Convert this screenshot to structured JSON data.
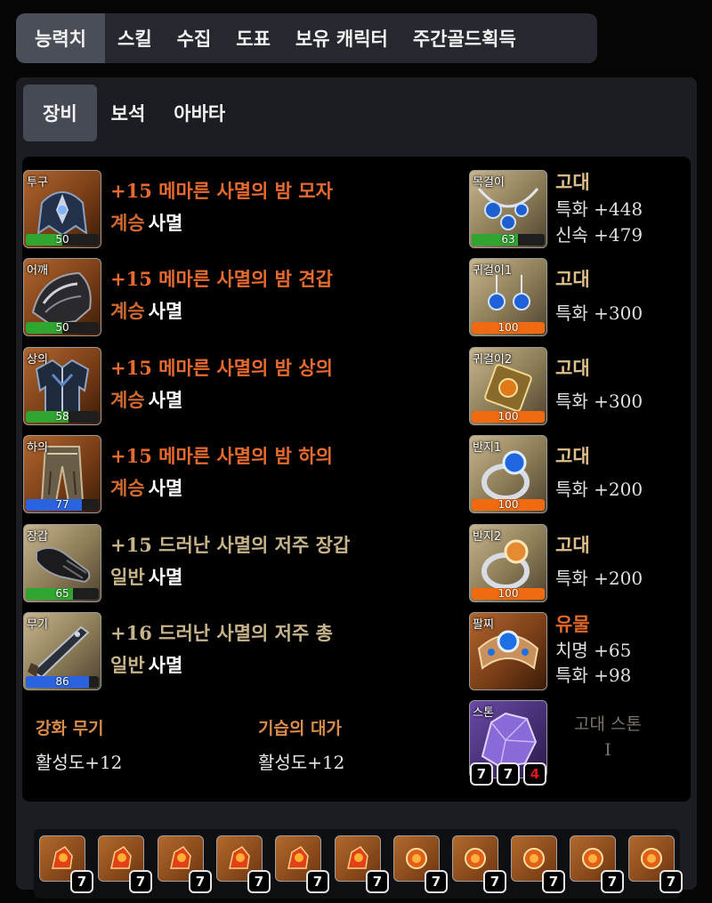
{
  "top_tabs": [
    "능력치",
    "스킬",
    "수집",
    "도표",
    "보유 캐릭터",
    "주간골드획득"
  ],
  "sub_tabs": [
    "장비",
    "보석",
    "아바타"
  ],
  "equipment": [
    {
      "slot": "투구",
      "name": "+15 메마른 사멸의 밤 모자",
      "tier": "계승",
      "set": "사멸",
      "quality": 50,
      "quality_color": "#2fa62f",
      "grade_style": "relic"
    },
    {
      "slot": "어깨",
      "name": "+15 메마른 사멸의 밤 견갑",
      "tier": "계승",
      "set": "사멸",
      "quality": 50,
      "quality_color": "#2fa62f",
      "grade_style": "relic"
    },
    {
      "slot": "상의",
      "name": "+15 메마른 사멸의 밤 상의",
      "tier": "계승",
      "set": "사멸",
      "quality": 58,
      "quality_color": "#2fa62f",
      "grade_style": "relic"
    },
    {
      "slot": "하의",
      "name": "+15 메마른 사멸의 밤 하의",
      "tier": "계승",
      "set": "사멸",
      "quality": 77,
      "quality_color": "#2a63e0",
      "grade_style": "relic"
    },
    {
      "slot": "장갑",
      "name": "+15 드러난 사멸의 저주 장갑",
      "tier": "일반",
      "set": "사멸",
      "quality": 65,
      "quality_color": "#2fa62f",
      "grade_style": "normal"
    },
    {
      "slot": "무기",
      "name": "+16 드러난 사멸의 저주 총",
      "tier": "일반",
      "set": "사멸",
      "quality": 86,
      "quality_color": "#2a63e0",
      "grade_style": "normal"
    }
  ],
  "accessories": [
    {
      "slot": "목걸이",
      "grade": "고대",
      "stats": [
        "특화 +448",
        "신속 +479"
      ],
      "quality": 63,
      "quality_color": "#2fa62f"
    },
    {
      "slot": "귀걸이1",
      "grade": "고대",
      "stats": [
        "특화 +300"
      ],
      "quality": 100,
      "quality_color": "#ef6a10"
    },
    {
      "slot": "귀걸이2",
      "grade": "고대",
      "stats": [
        "특화 +300"
      ],
      "quality": 100,
      "quality_color": "#ef6a10"
    },
    {
      "slot": "반지1",
      "grade": "고대",
      "stats": [
        "특화 +200"
      ],
      "quality": 100,
      "quality_color": "#ef6a10"
    },
    {
      "slot": "반지2",
      "grade": "고대",
      "stats": [
        "특화 +200"
      ],
      "quality": 100,
      "quality_color": "#ef6a10"
    }
  ],
  "bracelet": {
    "slot": "팔찌",
    "grade": "유물",
    "stats": [
      "치명 +65",
      "특화 +98"
    ]
  },
  "stone": {
    "slot": "스톤",
    "grade": "고대 스톤",
    "level": "I",
    "engravings": [
      "7",
      "7",
      "4"
    ]
  },
  "elixir": [
    {
      "label": "강화 무기",
      "value": "활성도+12"
    },
    {
      "label": "기습의 대가",
      "value": "활성도+12"
    }
  ],
  "gems": [
    "7",
    "7",
    "7",
    "7",
    "7",
    "7",
    "7",
    "7",
    "7",
    "7",
    "7"
  ],
  "colors": {
    "relic": "#e76a2e",
    "normal": "#c8b48a",
    "ancient": "#dfc08b",
    "quality_green": "#2fa62f",
    "quality_blue": "#2a63e0",
    "quality_orange": "#ef6a10"
  },
  "icons": [
    "helmet-icon",
    "shoulder-icon",
    "chest-icon",
    "pants-icon",
    "gloves-icon",
    "weapon-icon",
    "necklace-icon",
    "earring-icon",
    "ring-icon",
    "bracelet-icon",
    "stone-icon",
    "gem-icon"
  ]
}
